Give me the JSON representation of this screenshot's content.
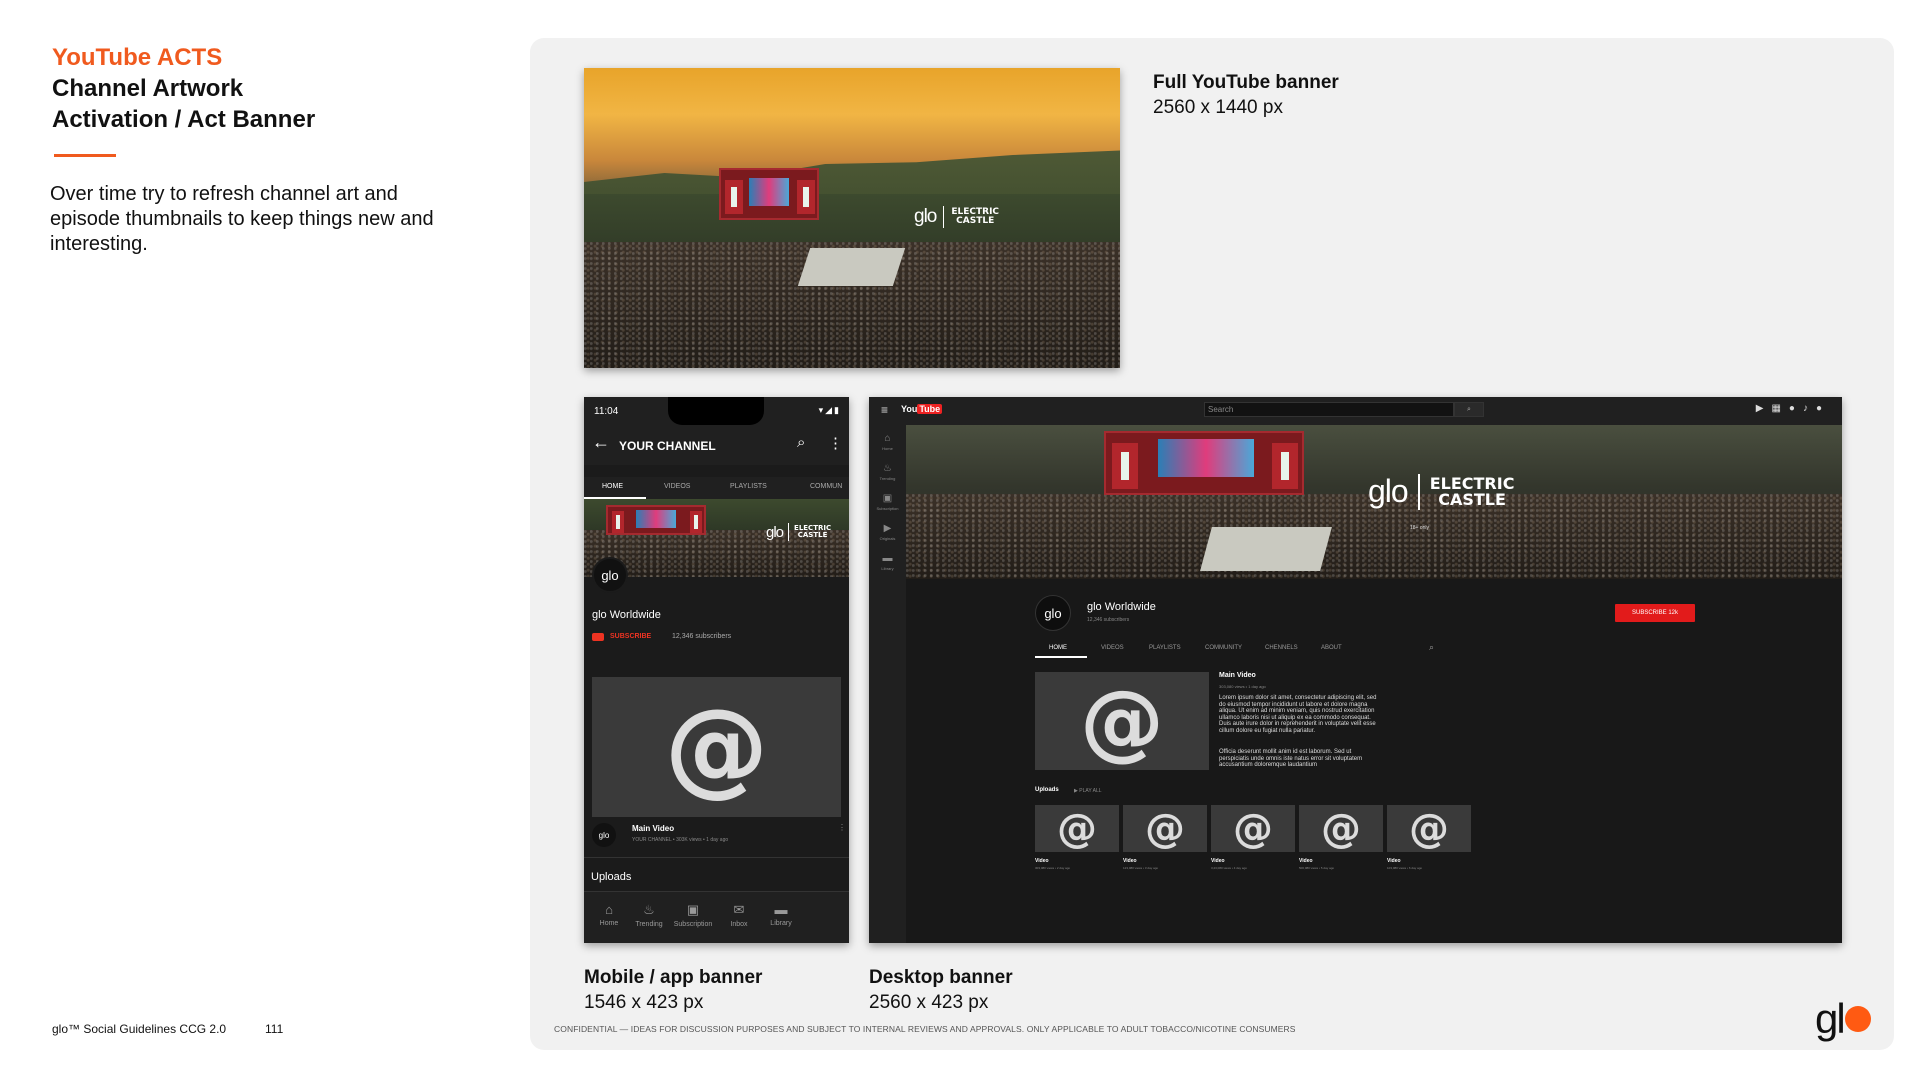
{
  "header": {
    "kicker": "YouTube ACTS",
    "title_line1": "Channel Artwork",
    "title_line2": "Activation / Act Banner"
  },
  "intro": "Over time try to refresh channel art and episode thumbnails to keep things new and interesting.",
  "footer": {
    "doc_name": "glo™ Social Guidelines CCG 2.0",
    "page_number": "111",
    "confidential": "CONFIDENTIAL — IDEAS FOR DISCUSSION PURPOSES AND SUBJECT TO INTERNAL REVIEWS AND APPROVALS. ONLY APPLICABLE TO ADULT TOBACCO/NICOTINE CONSUMERS",
    "logo_text": "gl"
  },
  "banner_brand": {
    "glo": "glo",
    "event_line1": "ELECTRIC",
    "event_line2": "CASTLE",
    "age_note": "18+ only"
  },
  "full_banner": {
    "title": "Full YouTube banner",
    "size": "2560 x 1440 px"
  },
  "mobile": {
    "caption_title": "Mobile / app banner",
    "caption_size": "1546 x 423 px",
    "time": "11:04",
    "status_icons": "▾◢▮",
    "channel_title": "YOUR CHANNEL",
    "tabs": [
      "HOME",
      "VIDEOS",
      "PLAYLISTS",
      "COMMUN"
    ],
    "avatar_text": "glo",
    "channel_name": "glo Worldwide",
    "subscribe": "SUBSCRIBE",
    "subscribers": "12,346 subscribers",
    "main_video_title": "Main Video",
    "main_video_meta": "YOUR CHANNEL • 303K views • 1 day ago",
    "uploads": "Uploads",
    "nav": [
      {
        "icon": "home-icon",
        "label": "Home"
      },
      {
        "icon": "trending-icon",
        "label": "Trending"
      },
      {
        "icon": "subscriptions-icon",
        "label": "Subscription"
      },
      {
        "icon": "inbox-icon",
        "label": "Inbox"
      },
      {
        "icon": "library-icon",
        "label": "Library"
      }
    ]
  },
  "desktop": {
    "caption_title": "Desktop banner",
    "caption_size": "2560 x 423 px",
    "logo_you": "You",
    "logo_tube": "Tube",
    "search_placeholder": "Search",
    "sidebar": [
      "Home",
      "Trending",
      "Subscription",
      "Originals",
      "Library"
    ],
    "avatar_text": "glo",
    "channel_name": "glo Worldwide",
    "subscribers": "12,346 subscribers",
    "subscribe": "SUBSCRIBE 12k",
    "tabs": [
      "HOME",
      "VIDEOS",
      "PLAYLISTS",
      "COMMUNITY",
      "CHENNELS",
      "ABOUT"
    ],
    "main_video_title": "Main Video",
    "main_video_meta": "303,080 views • 1 day ago",
    "desc_para1": "Lorem ipsum dolor sit amet, consectetur adipiscing elit, sed do eiusmod tempor incididunt ut labore et dolore magna aliqua. Ut enim ad minim veniam, quis nostrud exercitation ullamco laboris nisi ut aliquip ex ea commodo consequat. Duis aute irure dolor in reprehenderit in voluptate velit esse cillum dolore eu fugiat nulla pariatur.",
    "desc_para2": "Officia deserunt mollit anim id est laborum. Sed ut perspiciatis unde omnis iste natus error sit voluptatem accusantium doloremque laudantium",
    "uploads": "Uploads",
    "play_all": "▶ PLAY ALL",
    "videos": [
      {
        "title": "Video",
        "meta": "303,080 views • 2 day ago"
      },
      {
        "title": "Video",
        "meta": "123,080 views • 3 day ago"
      },
      {
        "title": "Video",
        "meta": "3,23,080 views • 4 day ago"
      },
      {
        "title": "Video",
        "meta": "500,080 views • 5 day ago"
      },
      {
        "title": "Video",
        "meta": "103,080 views • 6 day ago"
      }
    ]
  },
  "colors": {
    "accent_orange": "#f05a1e",
    "youtube_red": "#e21b1b",
    "panel_bg": "#f1f1f1",
    "dark_ui": "#181818"
  }
}
